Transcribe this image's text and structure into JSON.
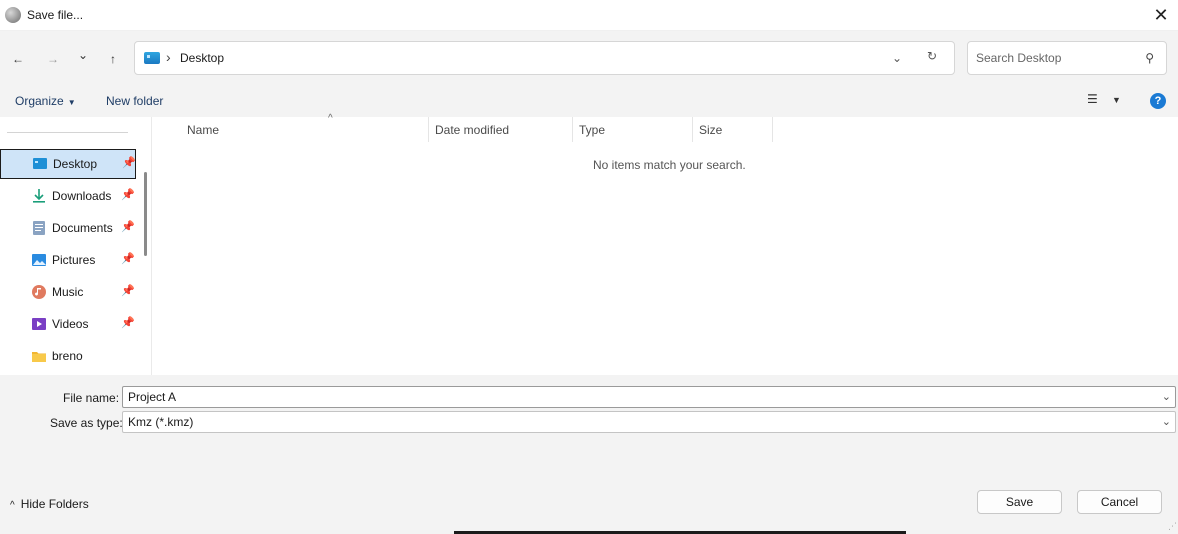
{
  "window": {
    "title": "Save file...",
    "close_glyph": "✕"
  },
  "nav": {
    "back_glyph": "←",
    "forward_glyph": "→",
    "recent_glyph": "⌄",
    "up_glyph": "↑",
    "breadcrumb_sep": "›",
    "location": "Desktop",
    "dropdown_glyph": "⌄",
    "refresh_glyph": "↻",
    "search_placeholder": "Search Desktop",
    "search_glyph": "⚲"
  },
  "toolbar": {
    "organize_label": "Organize",
    "organize_caret": "▼",
    "new_folder_label": "New folder",
    "view_glyph": "☰",
    "view_caret": "▼",
    "help_glyph": "?"
  },
  "sidebar": {
    "items": [
      {
        "label": "Desktop",
        "icon": "desktop-icon",
        "pinned": true
      },
      {
        "label": "Downloads",
        "icon": "download-icon",
        "pinned": true
      },
      {
        "label": "Documents",
        "icon": "document-icon",
        "pinned": true
      },
      {
        "label": "Pictures",
        "icon": "pictures-icon",
        "pinned": true
      },
      {
        "label": "Music",
        "icon": "music-icon",
        "pinned": true
      },
      {
        "label": "Videos",
        "icon": "videos-icon",
        "pinned": true
      },
      {
        "label": "breno",
        "icon": "folder-icon",
        "pinned": false
      }
    ],
    "pin_glyph": "📌"
  },
  "file_list": {
    "columns": [
      "Name",
      "Date modified",
      "Type",
      "Size"
    ],
    "sort_glyph": "^",
    "empty_message": "No items match your search."
  },
  "form": {
    "file_name_label": "File name:",
    "file_name_value": "Project A",
    "save_type_label": "Save as type:",
    "save_type_value": "Kmz (*.kmz)",
    "dropdown_glyph": "⌄"
  },
  "footer": {
    "hide_folders_caret": "^",
    "hide_folders_label": "Hide Folders",
    "save_label": "Save",
    "cancel_label": "Cancel",
    "grip_glyph": "⋰"
  },
  "colors": {
    "accent": "#1a7ad4",
    "selected_bg": "#cfe4f8",
    "chrome_bg": "#f3f3f3"
  }
}
